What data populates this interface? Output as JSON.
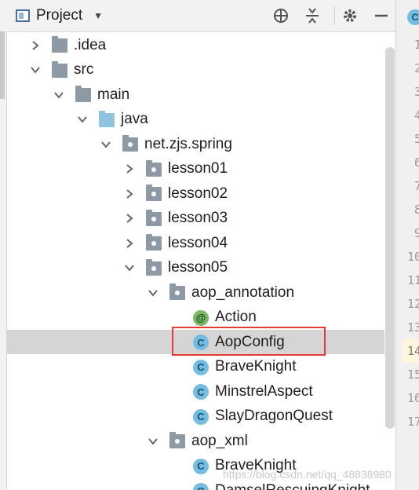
{
  "header": {
    "title": "Project",
    "icons": [
      "locate-icon",
      "collapse-all-icon",
      "gear-icon",
      "minimize-icon"
    ]
  },
  "tree": {
    "items": [
      {
        "label": ".idea",
        "icon": "folder",
        "expanded": false
      },
      {
        "label": "src",
        "icon": "folder",
        "expanded": true
      },
      {
        "label": "main",
        "icon": "folder",
        "expanded": true
      },
      {
        "label": "java",
        "icon": "folder-blue",
        "expanded": true
      },
      {
        "label": "net.zjs.spring",
        "icon": "package",
        "expanded": true
      },
      {
        "label": "lesson01",
        "icon": "package",
        "expanded": false
      },
      {
        "label": "lesson02",
        "icon": "package",
        "expanded": false
      },
      {
        "label": "lesson03",
        "icon": "package",
        "expanded": false
      },
      {
        "label": "lesson04",
        "icon": "package",
        "expanded": false
      },
      {
        "label": "lesson05",
        "icon": "package",
        "expanded": true
      },
      {
        "label": "aop_annotation",
        "icon": "package",
        "expanded": true
      },
      {
        "label": "Action",
        "icon": "annotation"
      },
      {
        "label": "AopConfig",
        "icon": "class",
        "selected": true
      },
      {
        "label": "BraveKnight",
        "icon": "class"
      },
      {
        "label": "MinstrelAspect",
        "icon": "class"
      },
      {
        "label": "SlayDragonQuest",
        "icon": "class"
      },
      {
        "label": "aop_xml",
        "icon": "package",
        "expanded": true
      },
      {
        "label": "BraveKnight",
        "icon": "class"
      },
      {
        "label": "DamselRescuingKnight",
        "icon": "class"
      }
    ],
    "class_icon_letter": "C",
    "annotation_icon_letter": "@"
  },
  "editor": {
    "line_numbers": [
      "1",
      "2",
      "3",
      "4",
      "5",
      "6",
      "7",
      "8",
      "9",
      "10",
      "11",
      "12",
      "13",
      "14",
      "15",
      "16",
      "17"
    ],
    "active_line": "14"
  },
  "watermark": "https://blog.csdn.net/qq_48838980"
}
